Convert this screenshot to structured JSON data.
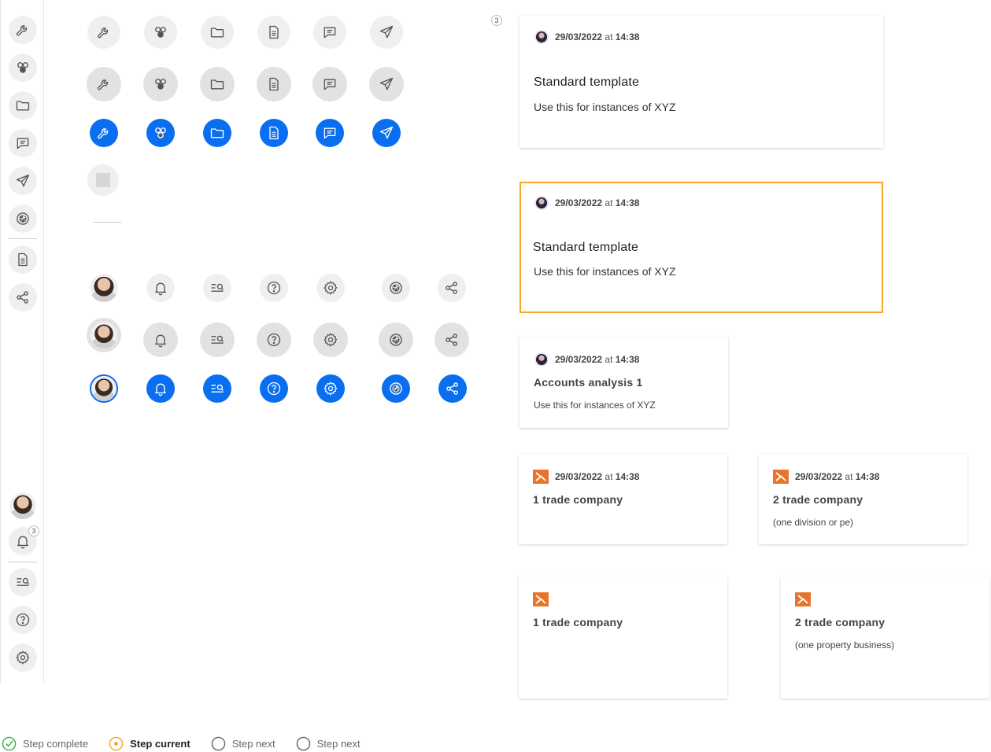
{
  "sidebar": {
    "items": [
      {
        "icon": "wrench-icon"
      },
      {
        "icon": "circles-icon"
      },
      {
        "icon": "folder-icon"
      },
      {
        "icon": "chat-icon"
      },
      {
        "icon": "send-icon"
      },
      {
        "icon": "aperture-icon"
      },
      {
        "icon": "document-icon"
      },
      {
        "icon": "share-icon"
      }
    ],
    "bottom": [
      {
        "icon": "avatar"
      },
      {
        "icon": "bell-icon",
        "badge": "3"
      },
      {
        "icon": "search-list-icon"
      },
      {
        "icon": "help-icon"
      },
      {
        "icon": "gear-icon"
      }
    ]
  },
  "grid": {
    "top_badge": "3"
  },
  "cards": [
    {
      "date": "29/03/2022",
      "at": "at",
      "time": "14:38",
      "title": "Standard template",
      "desc": "Use this for instances of XYZ"
    },
    {
      "date": "29/03/2022",
      "at": "at",
      "time": "14:38",
      "title": "Standard template",
      "desc": "Use this for instances of XYZ"
    },
    {
      "date": "29/03/2022",
      "at": "at",
      "time": "14:38",
      "title": "Accounts analysis 1",
      "desc": "Use this for instances of XYZ"
    },
    {
      "date": "29/03/2022",
      "at": "at",
      "time": "14:38",
      "title": "1 trade company",
      "desc": ""
    },
    {
      "date": "29/03/2022",
      "at": "at",
      "time": "14:38",
      "title": "2 trade company",
      "desc": "(one division or pe)"
    },
    {
      "title": "1 trade company",
      "desc": ""
    },
    {
      "title": "2 trade company",
      "desc": "(one property business)"
    }
  ],
  "steps": [
    {
      "label": "Step complete",
      "state": "complete"
    },
    {
      "label": "Step current",
      "state": "current"
    },
    {
      "label": "Step next",
      "state": "next"
    },
    {
      "label": "Step next",
      "state": "next"
    }
  ],
  "colors": {
    "accent": "#0a6ef0",
    "selected": "#f5a623",
    "brand": "#e8742a"
  }
}
